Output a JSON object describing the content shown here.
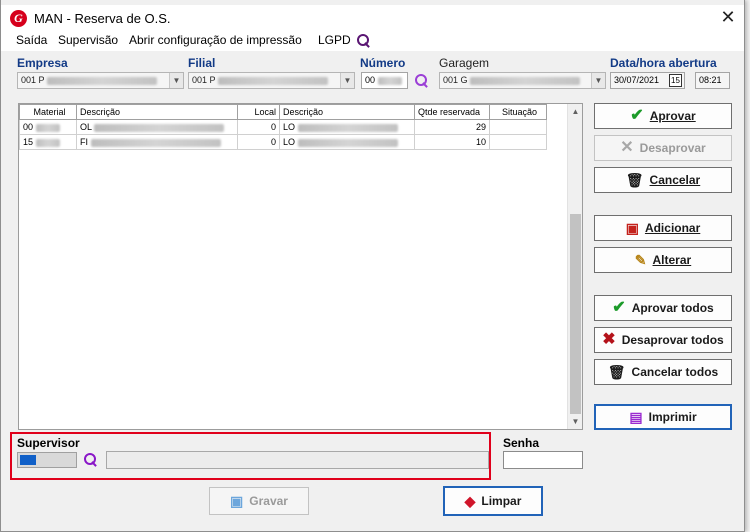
{
  "window": {
    "title": "MAN - Reserva de O.S.",
    "close_label": "✕"
  },
  "menu": [
    "Saída",
    "Supervisão",
    "Abrir configuração de impressão",
    "LGPD"
  ],
  "header": {
    "empresa_label": "Empresa",
    "empresa_value": "001 P",
    "filial_label": "Filial",
    "filial_value": "001 P",
    "numero_label": "Número",
    "numero_value": "00",
    "garagem_label": "Garagem",
    "garagem_value": "001 G",
    "data_label": "Data/hora abertura",
    "data_value": "30/07/2021",
    "calendar_label": "15",
    "hora_value": "08:21"
  },
  "table": {
    "columns": [
      "Material",
      "Descrição",
      "Local",
      "Descrição",
      "Qtde reservada",
      "Situação"
    ],
    "rows": [
      [
        "00",
        "OL",
        "0",
        "LO",
        "29",
        ""
      ],
      [
        "15",
        "FI",
        "0",
        "LO",
        "10",
        ""
      ]
    ]
  },
  "buttons": {
    "aprovar": "Aprovar",
    "desaprovar": "Desaprovar",
    "cancelar": "Cancelar",
    "adicionar": "Adicionar",
    "alterar": "Alterar",
    "aprovar_todos": "Aprovar todos",
    "desaprovar_todos": "Desaprovar todos",
    "cancelar_todos": "Cancelar todos",
    "imprimir": "Imprimir",
    "gravar": "Gravar",
    "limpar": "Limpar"
  },
  "supervisor": {
    "label": "Supervisor",
    "senha_label": "Senha"
  },
  "icons": {
    "search": "search-icon",
    "lgpd_search": "search-icon"
  },
  "colors": {
    "accent": "#123a86",
    "highlight_box": "#e0001b",
    "search_purple": "#8a17c8",
    "approve_green": "#1c9b2a",
    "reject_red": "#b4121a"
  }
}
